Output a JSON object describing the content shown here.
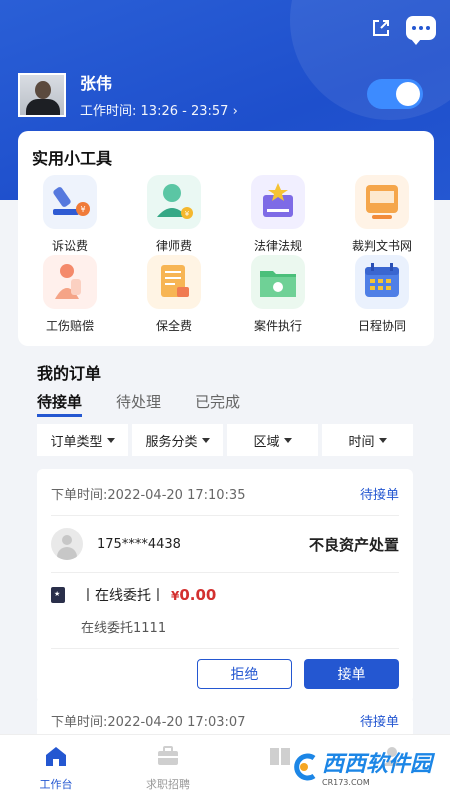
{
  "profile": {
    "name": "张伟",
    "work_time_label": "工作时间:",
    "work_time": "13:26 - 23:57",
    "chevron": "›"
  },
  "tools": {
    "title": "实用小工具",
    "items": [
      {
        "label": "诉讼费",
        "icon": "gavel-icon"
      },
      {
        "label": "律师费",
        "icon": "lawyer-icon"
      },
      {
        "label": "法律法规",
        "icon": "law-book-icon"
      },
      {
        "label": "裁判文书网",
        "icon": "document-window-icon"
      },
      {
        "label": "工伤赔偿",
        "icon": "injury-icon"
      },
      {
        "label": "保全费",
        "icon": "bill-icon"
      },
      {
        "label": "案件执行",
        "icon": "folder-icon"
      },
      {
        "label": "日程协同",
        "icon": "calendar-icon"
      }
    ]
  },
  "orders": {
    "title": "我的订单",
    "tabs": [
      {
        "label": "待接单",
        "active": true
      },
      {
        "label": "待处理",
        "active": false
      },
      {
        "label": "已完成",
        "active": false
      }
    ],
    "filters": [
      "订单类型",
      "服务分类",
      "区域",
      "时间"
    ],
    "cards": [
      {
        "time_label": "下单时间:",
        "time": "2022-04-20 17:10:35",
        "status": "待接单",
        "phone": "175****4438",
        "service": "不良资产处置",
        "type": "丨在线委托丨",
        "currency": "¥",
        "price": "0.00",
        "description": "在线委托1111",
        "reject_label": "拒绝",
        "accept_label": "接单"
      },
      {
        "time_label": "下单时间:",
        "time": "2022-04-20 17:03:07",
        "status": "待接单"
      }
    ]
  },
  "bottom_nav": [
    {
      "label": "工作台",
      "icon": "home-icon",
      "active": true
    },
    {
      "label": "求职招聘",
      "icon": "briefcase-icon",
      "active": false
    },
    {
      "label": "",
      "icon": "book-nav-icon",
      "active": false
    },
    {
      "label": "",
      "icon": "user-nav-icon",
      "active": false
    }
  ],
  "watermark": {
    "main": "西西软件园",
    "sub": "CR173.COM"
  },
  "colors": {
    "primary": "#2457d1",
    "price": "#d3302f",
    "toggle": "#3d8bff"
  }
}
